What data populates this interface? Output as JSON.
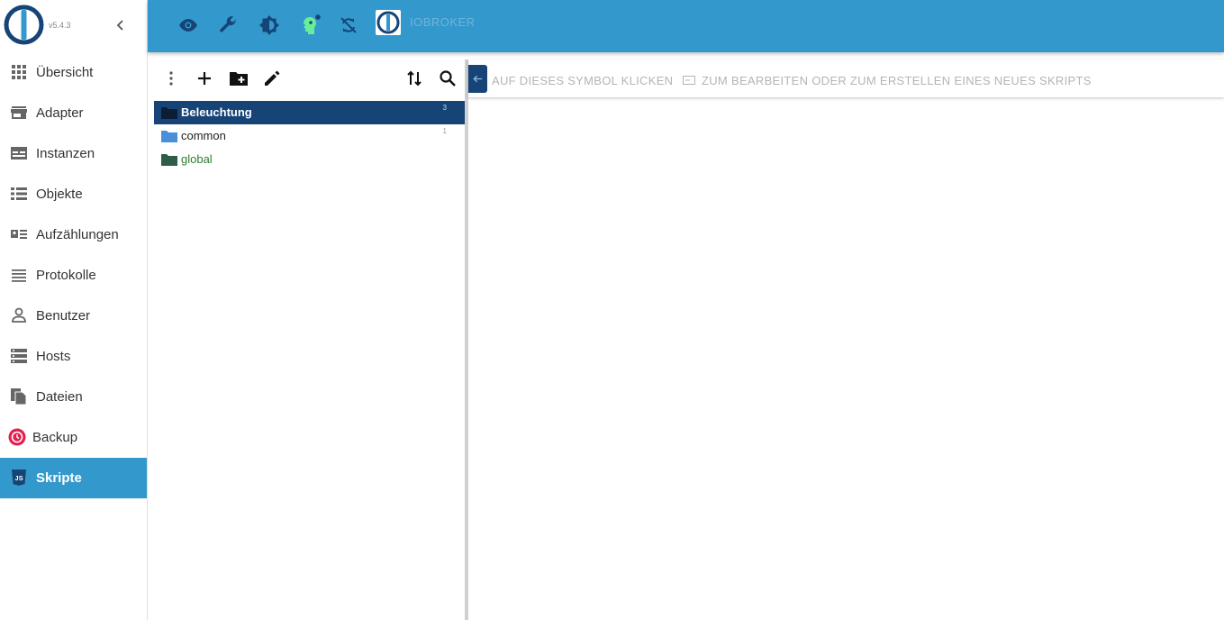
{
  "app": {
    "version": "v5.4.3",
    "title": "IOBROKER"
  },
  "sidebar": {
    "items": [
      {
        "label": "Übersicht",
        "icon": "grid-icon"
      },
      {
        "label": "Adapter",
        "icon": "store-icon"
      },
      {
        "label": "Instanzen",
        "icon": "instances-icon"
      },
      {
        "label": "Objekte",
        "icon": "list-icon"
      },
      {
        "label": "Aufzählungen",
        "icon": "enum-icon"
      },
      {
        "label": "Protokolle",
        "icon": "log-icon"
      },
      {
        "label": "Benutzer",
        "icon": "person-icon"
      },
      {
        "label": "Hosts",
        "icon": "server-icon"
      },
      {
        "label": "Dateien",
        "icon": "files-icon"
      },
      {
        "label": "Backup",
        "icon": "backup-icon"
      },
      {
        "label": "Skripte",
        "icon": "javascript-icon"
      }
    ],
    "active": "Skripte"
  },
  "topbar": {
    "icons": [
      "eye-icon",
      "wrench-icon",
      "brightness-icon",
      "expert-mode-icon",
      "sync-disabled-icon"
    ]
  },
  "tree": {
    "items": [
      {
        "name": "Beleuchtung",
        "count": "3",
        "selected": true
      },
      {
        "name": "common",
        "count": "1",
        "selected": false
      },
      {
        "name": "global",
        "count": "",
        "selected": false
      }
    ]
  },
  "hint": {
    "part1": "AUF DIESES SYMBOL KLICKEN",
    "part2": "ZUM BEARBEITEN ODER ZUM ERSTELLEN EINES NEUES SKRIPTS"
  },
  "colors": {
    "primary": "#3399cc",
    "selected": "#164477",
    "global_folder": "#2e7d32",
    "common_folder": "#4a90d9"
  }
}
